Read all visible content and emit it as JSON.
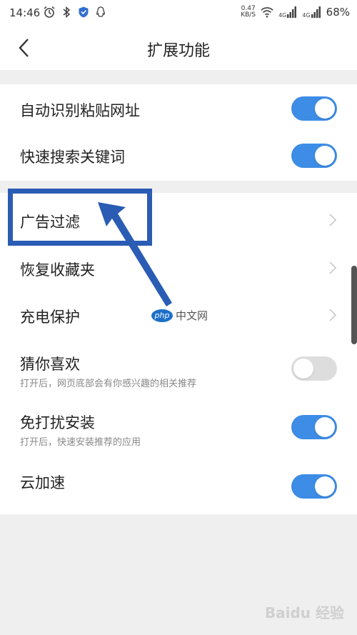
{
  "status_bar": {
    "time": "14:46",
    "net_speed_value": "0.47",
    "net_speed_unit": "KB/S",
    "signal1": "4G",
    "signal2": "4G",
    "battery": "68%"
  },
  "header": {
    "title": "扩展功能"
  },
  "settings": {
    "group1": [
      {
        "label": "自动识别粘贴网址",
        "toggle": "on"
      },
      {
        "label": "快速搜索关键词",
        "toggle": "on"
      }
    ],
    "group2": [
      {
        "label": "广告过滤",
        "type": "link"
      },
      {
        "label": "恢复收藏夹",
        "type": "link"
      },
      {
        "label": "充电保护",
        "type": "link"
      },
      {
        "label": "猜你喜欢",
        "sub": "打开后，网页底部会有你感兴趣的相关推荐",
        "toggle": "off"
      },
      {
        "label": "免打扰安装",
        "sub": "打开后，快速安装推荐的应用",
        "toggle": "on"
      },
      {
        "label": "云加速",
        "toggle": "on"
      }
    ]
  },
  "watermarks": {
    "php_logo": "php",
    "php_text": "中文网",
    "baidu": "Baidu 经验"
  },
  "colors": {
    "accent": "#3d8ce6",
    "toggle_off": "#dddddd",
    "annotation": "#2a5cb4",
    "background": "#efefef"
  }
}
